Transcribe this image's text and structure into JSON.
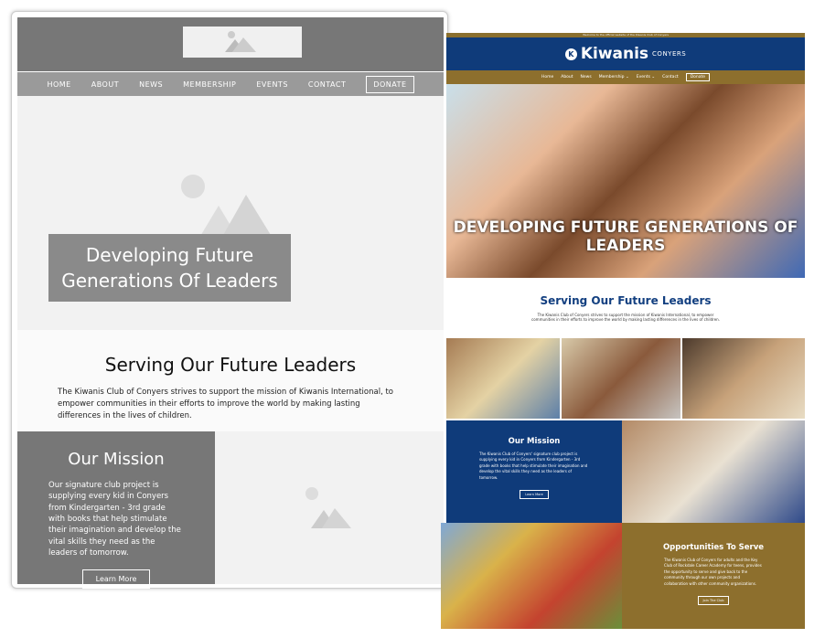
{
  "wireframe": {
    "nav": [
      "HOME",
      "ABOUT",
      "NEWS",
      "MEMBERSHIP",
      "EVENTS",
      "CONTACT"
    ],
    "donate": "DONATE",
    "hero_title": "Developing Future Generations Of Leaders",
    "section_title": "Serving Our Future Leaders",
    "section_text": "The Kiwanis Club of Conyers strives to support the mission of Kiwanis International, to empower communities in their efforts to improve the world by making lasting differences in the lives of children.",
    "mission_title": "Our Mission",
    "mission_text": "Our signature club project is supplying every kid in Conyers from Kindergarten - 3rd grade with books that help stimulate their imagination and develop the vital skills they need as the leaders of tomorrow.",
    "learn_more": "Learn More"
  },
  "mockup": {
    "top_strip": "Welcome to the official website of the Kiwanis Club of Conyers",
    "logo_initial": "K",
    "brand": "Kiwanis",
    "brand_sub": "CONYERS",
    "nav": [
      "Home",
      "About",
      "News",
      "Membership ⌄",
      "Events ⌄",
      "Contact"
    ],
    "donate": "Donate",
    "hero_title": "DEVELOPING FUTURE GENERATIONS OF LEADERS",
    "section_title": "Serving Our Future Leaders",
    "section_text": "The Kiwanis Club of Conyers strives to support the mission of Kiwanis International, to empower communities in their efforts to improve the world by making lasting differences in the lives of children.",
    "mission_title": "Our Mission",
    "mission_text": "The Kiwanis Club of Conyers' signature club project is supplying every kid in Conyers from Kindergarten - 3rd grade with books that help stimulate their imagination and develop the vital skills they need as the leaders of tomorrow.",
    "learn_more": "Learn More",
    "opp_title": "Opportunities To Serve",
    "opp_text": "The Kiwanis Club of Conyers for adults and the Key Club of Rockdale Career Academy for teens, provides the opportunity to serve and give back to the community through our own projects and collaboration with other community organizations.",
    "join": "Join The Club",
    "colors": {
      "blue": "#0f3b7a",
      "gold": "#8d6f2d"
    }
  }
}
